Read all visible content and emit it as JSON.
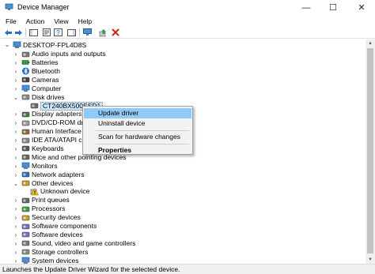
{
  "window": {
    "title": "Device Manager",
    "minimize": "—",
    "maximize": "☐",
    "close": "✕"
  },
  "menu": [
    "File",
    "Action",
    "View",
    "Help"
  ],
  "toolbar": [
    "back-icon",
    "forward-icon",
    "show-hide-tree-icon",
    "properties-icon",
    "help-icon",
    "action-pane-icon",
    "scan-hardware-icon",
    "update-driver-icon",
    "uninstall-icon"
  ],
  "tree": {
    "root": "DESKTOP-FPL4D8S",
    "items": [
      {
        "label": "Audio inputs and outputs",
        "icon": "speaker-icon",
        "state": "collapsed",
        "level": 1
      },
      {
        "label": "Batteries",
        "icon": "battery-icon",
        "state": "collapsed",
        "level": 1
      },
      {
        "label": "Bluetooth",
        "icon": "bluetooth-icon",
        "state": "collapsed",
        "level": 1
      },
      {
        "label": "Cameras",
        "icon": "camera-icon",
        "state": "collapsed",
        "level": 1
      },
      {
        "label": "Computer",
        "icon": "computer-icon",
        "state": "collapsed",
        "level": 1
      },
      {
        "label": "Disk drives",
        "icon": "disk-drive-icon",
        "state": "expanded",
        "level": 1
      },
      {
        "label": "CT240BX500SSD1",
        "icon": "disk-icon",
        "state": "leaf",
        "level": 2,
        "selected": true
      },
      {
        "label": "Display adapters",
        "icon": "display-adapter-icon",
        "state": "collapsed",
        "level": 1
      },
      {
        "label": "DVD/CD-ROM drive",
        "icon": "dvd-icon",
        "state": "collapsed",
        "level": 1
      },
      {
        "label": "Human Interface De",
        "icon": "hid-icon",
        "state": "collapsed",
        "level": 1
      },
      {
        "label": "IDE ATA/ATAPI contr",
        "icon": "ide-icon",
        "state": "collapsed",
        "level": 1
      },
      {
        "label": "Keyboards",
        "icon": "keyboard-icon",
        "state": "collapsed",
        "level": 1
      },
      {
        "label": "Mice and other pointing devices",
        "icon": "mouse-icon",
        "state": "collapsed",
        "level": 1
      },
      {
        "label": "Monitors",
        "icon": "monitor-icon",
        "state": "collapsed",
        "level": 1
      },
      {
        "label": "Network adapters",
        "icon": "network-icon",
        "state": "collapsed",
        "level": 1
      },
      {
        "label": "Other devices",
        "icon": "other-devices-icon",
        "state": "expanded",
        "level": 1
      },
      {
        "label": "Unknown device",
        "icon": "unknown-device-icon",
        "state": "leaf",
        "level": 2
      },
      {
        "label": "Print queues",
        "icon": "printer-icon",
        "state": "collapsed",
        "level": 1
      },
      {
        "label": "Processors",
        "icon": "processor-icon",
        "state": "collapsed",
        "level": 1
      },
      {
        "label": "Security devices",
        "icon": "security-icon",
        "state": "collapsed",
        "level": 1
      },
      {
        "label": "Software components",
        "icon": "software-icon",
        "state": "collapsed",
        "level": 1
      },
      {
        "label": "Software devices",
        "icon": "software-icon",
        "state": "collapsed",
        "level": 1
      },
      {
        "label": "Sound, video and game controllers",
        "icon": "speaker-icon",
        "state": "collapsed",
        "level": 1
      },
      {
        "label": "Storage controllers",
        "icon": "storage-icon",
        "state": "collapsed",
        "level": 1
      },
      {
        "label": "System devices",
        "icon": "computer-icon",
        "state": "collapsed",
        "level": 1
      }
    ]
  },
  "context_menu": {
    "update_driver": "Update driver",
    "uninstall_device": "Uninstall device",
    "scan_hardware": "Scan for hardware changes",
    "properties": "Properties"
  },
  "status": "Launches the Update Driver Wizard for the selected device.",
  "colors": {
    "selection": "#cce8ff",
    "menu_highlight": "#91c9f7",
    "chrome": "#f0f0f0"
  }
}
